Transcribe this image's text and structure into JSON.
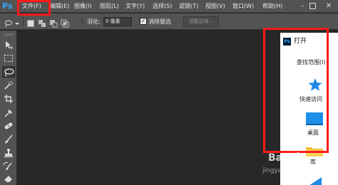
{
  "app": {
    "logo": "Ps"
  },
  "menu": {
    "items": [
      "文件(F)",
      "编辑(E)",
      "图像(I)",
      "图层(L)",
      "文字(Y)",
      "选择(S)",
      "滤镜(T)",
      "视图(V)",
      "窗口(W)",
      "帮助(H)"
    ]
  },
  "window_controls": {
    "minimize": "–",
    "close": "✕"
  },
  "options": {
    "feather_label": "羽化:",
    "feather_value": "0 像素",
    "antialias_label": "消除锯齿",
    "antialias_checked": true,
    "refine_edge": "调整边缘..."
  },
  "toolbar": {
    "tools": [
      {
        "name": "move-tool-icon"
      },
      {
        "name": "marquee-tool-icon"
      },
      {
        "name": "lasso-tool-icon",
        "active": true
      },
      {
        "name": "quick-selection-tool-icon"
      },
      {
        "name": "crop-tool-icon"
      },
      {
        "name": "eyedropper-tool-icon"
      },
      {
        "name": "spot-healing-tool-icon"
      },
      {
        "name": "brush-tool-icon"
      },
      {
        "name": "clone-stamp-tool-icon"
      },
      {
        "name": "history-brush-tool-icon"
      },
      {
        "name": "eraser-tool-icon"
      },
      {
        "name": "gradient-tool-icon"
      }
    ]
  },
  "dialog": {
    "title": "打开",
    "look_in_label": "查找范围(I)",
    "places": [
      {
        "label": "快速访问",
        "icon": "star-icon"
      },
      {
        "label": "桌面",
        "icon": "desktop-icon"
      },
      {
        "label": "库",
        "icon": "library-icon"
      }
    ]
  },
  "watermark": {
    "logo": "Bai",
    "url": "jingyan.baidu.com"
  },
  "colors": {
    "highlight": "#ff1a1a",
    "ps_blue": "#31a8ff",
    "panel": "#535353",
    "workspace": "#282828"
  }
}
